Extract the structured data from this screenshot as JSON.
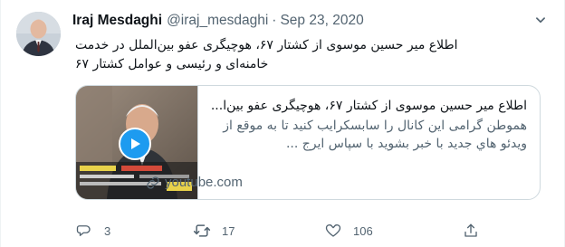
{
  "tweet": {
    "author": {
      "display_name": "Iraj Mesdaghi",
      "handle": "@iraj_mesdaghi",
      "separator": "·",
      "date": "Sep 23, 2020"
    },
    "text_lines": [
      "اطلاع میر حسین موسوی از کشتار ۶۷، هوچیگری عفو بین‌الملل در خدمت",
      "خامنه‌ای و رئیسی و عوامل کشتار ۶۷"
    ],
    "card": {
      "title": "اطلاع میر حسین موسوی از کشتار ۶۷، هوچیگری عفو بین‌ا...",
      "description": "هموطن گرامی این کانال را سابسکرایب کنید تا به موقع از ویدئو هاي جدید با خبر بشوید با سپاس ایرج ...",
      "domain": "youtube.com",
      "icons": {
        "play": "play-icon",
        "link": "link-icon"
      }
    },
    "actions": {
      "reply_count": "3",
      "retweet_count": "17",
      "like_count": "106",
      "icons": {
        "reply": "reply-icon",
        "retweet": "retweet-icon",
        "like": "heart-icon",
        "share": "share-icon"
      }
    },
    "colors": {
      "accent": "#1d9bf0",
      "secondary_text": "#536471",
      "border": "#cfd9de"
    }
  }
}
